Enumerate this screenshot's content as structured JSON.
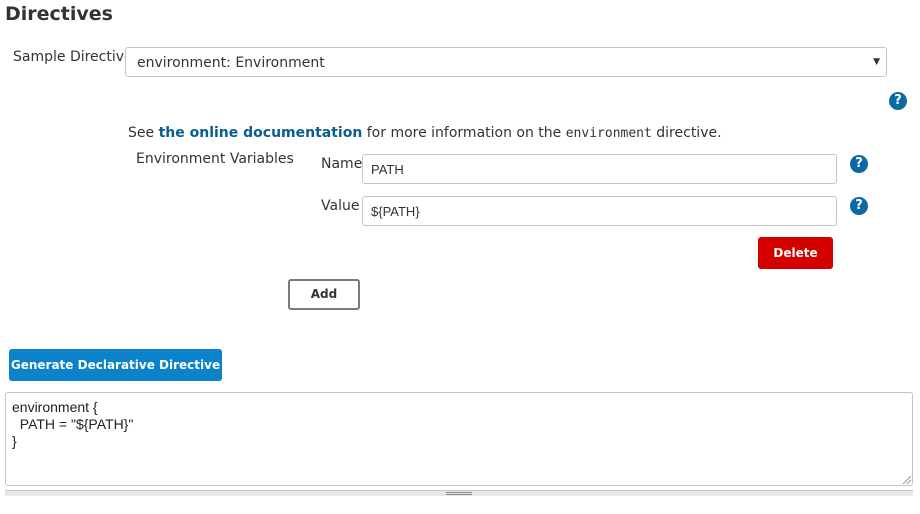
{
  "header": {
    "title": "Directives"
  },
  "sample_directive": {
    "label": "Sample Directive",
    "selected": "environment: Environment",
    "arrow_glyph": "▼"
  },
  "help": {
    "glyph": "?"
  },
  "documentation": {
    "prefix": "See ",
    "link_text": "the online documentation",
    "middle": " for more information on the ",
    "code": "environment",
    "suffix": " directive."
  },
  "environment": {
    "section_label": "Environment Variables",
    "name_label": "Name",
    "name_value": "PATH",
    "value_label": "Value",
    "value_value": "${PATH}",
    "delete_label": "Delete",
    "add_label": "Add"
  },
  "generate": {
    "label": "Generate Declarative Directive"
  },
  "output": {
    "text": "environment {\n  PATH = \"${PATH}\"\n}"
  },
  "colors": {
    "help_icon": "#0b6aa2",
    "link": "#0b5d8f",
    "delete_button": "#d40000",
    "generate_button": "#0b82c9"
  },
  "icons": {
    "help": "question-circle-icon",
    "dropdown": "chevron-down-icon"
  }
}
